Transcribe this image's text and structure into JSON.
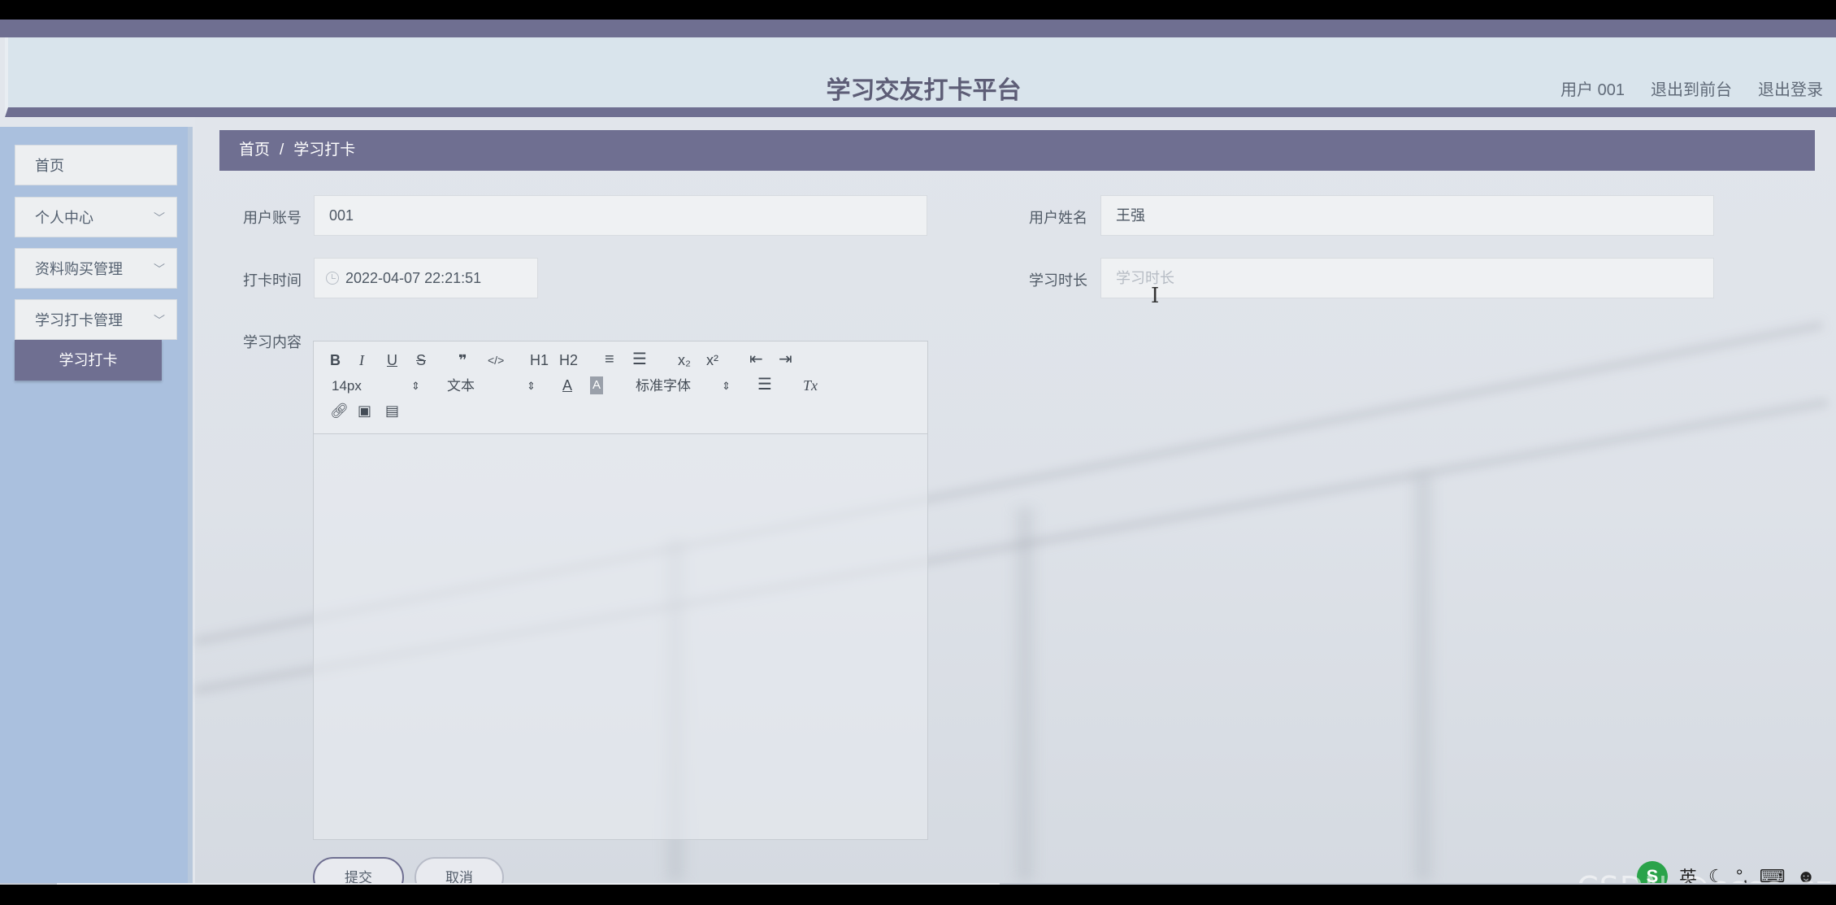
{
  "header": {
    "title": "学习交友打卡平台",
    "user": "用户 001",
    "to_front": "退出到前台",
    "logout": "退出登录"
  },
  "sidebar": {
    "items": [
      {
        "label": "首页",
        "icon": "none"
      },
      {
        "label": "个人中心",
        "icon": "chevron-down-icon"
      },
      {
        "label": "资料购买管理",
        "icon": "chevron-down-icon"
      },
      {
        "label": "学习打卡管理",
        "icon": "chevron-down-icon"
      }
    ],
    "active_sub": "学习打卡"
  },
  "breadcrumb": {
    "home": "首页",
    "separator": "/",
    "current": "学习打卡"
  },
  "form": {
    "account_label": "用户账号",
    "account_value": "001",
    "name_label": "用户姓名",
    "name_value": "王强",
    "time_label": "打卡时间",
    "time_value": "2022-04-07 22:21:51",
    "duration_label": "学习时长",
    "duration_placeholder": "学习时长",
    "content_label": "学习内容"
  },
  "editor": {
    "row1": [
      "B",
      "I",
      "U",
      "S",
      "❞",
      "</>",
      "H1",
      "H2",
      "≡",
      "☰",
      "x₂",
      "x²",
      "⇤",
      "⇥"
    ],
    "font_size": "14px",
    "text_type": "文本",
    "font_color_icon": "A",
    "bg_color_icon": "A",
    "font_family": "标准字体",
    "align_icon": "align-icon",
    "clear_icon": "Tx",
    "row3_icons": [
      "link-icon",
      "image-icon",
      "video-icon"
    ]
  },
  "buttons": {
    "submit": "提交",
    "cancel": "取消"
  },
  "watermark": "CSDN @cccc_cz",
  "tray": {
    "ime": "S",
    "lang": "英"
  },
  "colors": {
    "accent": "#6f6f91",
    "sidebar": "#aac0de",
    "header": "#d9e4ec"
  }
}
